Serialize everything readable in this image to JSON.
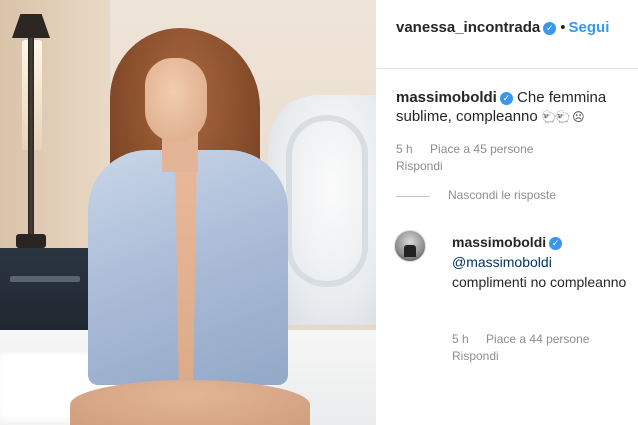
{
  "post": {
    "author": "vanessa_incontrada",
    "separator": "•",
    "follow_label": "Segui"
  },
  "comments": [
    {
      "username": "massimoboldi",
      "text": "Che femmina sublime, compleanno",
      "emoji": "🐑🐑 ☹",
      "time": "5 h",
      "likes": "Piace a 45 persone",
      "reply_label": "Rispondi"
    }
  ],
  "hide_replies_label": "Nascondi le risposte",
  "replies": [
    {
      "username": "massimoboldi",
      "mention": "@massimoboldi",
      "text": "complimenti no compleanno",
      "time": "5 h",
      "likes": "Piace a 44 persone",
      "reply_label": "Rispondi"
    }
  ],
  "icons": {
    "verified": "verified-badge-icon"
  },
  "colors": {
    "link_blue": "#3897f0",
    "meta_gray": "#8e8e8e",
    "mention_blue": "#003569"
  }
}
